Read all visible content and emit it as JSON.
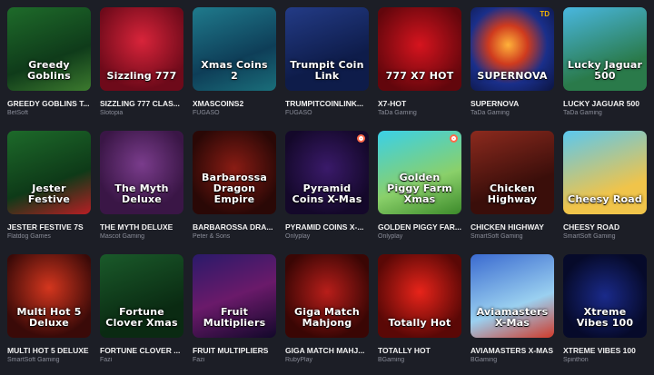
{
  "games": [
    {
      "title": "GREEDY GOBLINS T...",
      "provider": "BetSoft",
      "art": "Greedy Goblins"
    },
    {
      "title": "SIZZLING 777 CLAS...",
      "provider": "Slotopia",
      "art": "Sizzling 777"
    },
    {
      "title": "XMASCOINS2",
      "provider": "FUGASO",
      "art": "Xmas Coins 2"
    },
    {
      "title": "TRUMPITCOINLINK...",
      "provider": "FUGASO",
      "art": "Trumpit Coin Link"
    },
    {
      "title": "X7-HOT",
      "provider": "TaDa Gaming",
      "art": "777 X7 HOT"
    },
    {
      "title": "SUPERNOVA",
      "provider": "TaDa Gaming",
      "art": "SUPERNOVA",
      "badge": "TD"
    },
    {
      "title": "LUCKY JAGUAR 500",
      "provider": "TaDa Gaming",
      "art": "Lucky Jaguar 500"
    },
    {
      "title": "JESTER FESTIVE 7S",
      "provider": "Flatdog Games",
      "art": "Jester Festive"
    },
    {
      "title": "THE MYTH DELUXE",
      "provider": "Mascot Gaming",
      "art": "The Myth Deluxe"
    },
    {
      "title": "BARBAROSSA DRA...",
      "provider": "Peter & Sons",
      "art": "Barbarossa Dragon Empire"
    },
    {
      "title": "PYRAMID COINS X-...",
      "provider": "Onlyplay",
      "art": "Pyramid Coins X-Mas"
    },
    {
      "title": "GOLDEN PIGGY FAR...",
      "provider": "Onlyplay",
      "art": "Golden Piggy Farm Xmas"
    },
    {
      "title": "CHICKEN HIGHWAY",
      "provider": "SmartSoft Gaming",
      "art": "Chicken Highway"
    },
    {
      "title": "CHEESY ROAD",
      "provider": "SmartSoft Gaming",
      "art": "Cheesy Road"
    },
    {
      "title": "MULTI HOT 5 DELUXE",
      "provider": "SmartSoft Gaming",
      "art": "Multi Hot 5 Deluxe"
    },
    {
      "title": "FORTUNE CLOVER ...",
      "provider": "Fazi",
      "art": "Fortune Clover Xmas"
    },
    {
      "title": "FRUIT MULTIPLIERS",
      "provider": "Fazi",
      "art": "Fruit Multipliers"
    },
    {
      "title": "GIGA MATCH MAHJ...",
      "provider": "RubyPlay",
      "art": "Giga Match Mahjong"
    },
    {
      "title": "TOTALLY HOT",
      "provider": "BGaming",
      "art": "Totally Hot"
    },
    {
      "title": "AVIAMASTERS X-MAS",
      "provider": "BGaming",
      "art": "Aviamasters X-Mas"
    },
    {
      "title": "XTREME VIBES 100",
      "provider": "Spinthon",
      "art": "Xtreme Vibes 100"
    }
  ]
}
